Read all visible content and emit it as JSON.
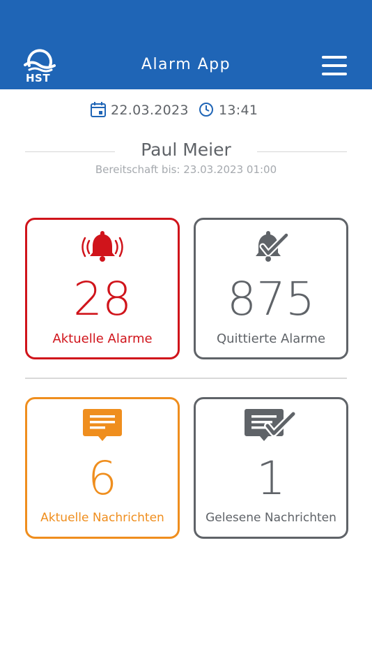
{
  "header": {
    "logo_text": "HST",
    "title": "Alarm App",
    "menu_icon": "hamburger-menu-icon"
  },
  "datetime": {
    "date": "22.03.2023",
    "time": "13:41",
    "date_icon": "calendar-icon",
    "time_icon": "clock-icon"
  },
  "user": {
    "name": "Paul Meier",
    "standby": "Bereitschaft bis: 23.03.2023 01:00"
  },
  "cards": {
    "current_alarms": {
      "count": "28",
      "label": "Aktuelle Alarme",
      "icon": "ringing-bell-icon",
      "color": "#d0141b"
    },
    "acknowledged_alarms": {
      "count": "875",
      "label": "Quittierte Alarme",
      "icon": "bell-check-icon",
      "color": "#5f6368"
    },
    "current_messages": {
      "count": "6",
      "label": "Aktuelle Nachrichten",
      "icon": "message-icon",
      "color": "#ef8e1e"
    },
    "read_messages": {
      "count": "1",
      "label": "Gelesene Nachrichten",
      "icon": "message-check-icon",
      "color": "#5f6368"
    }
  },
  "colors": {
    "header_bg": "#1f65b6",
    "text_gray": "#5f6368"
  }
}
